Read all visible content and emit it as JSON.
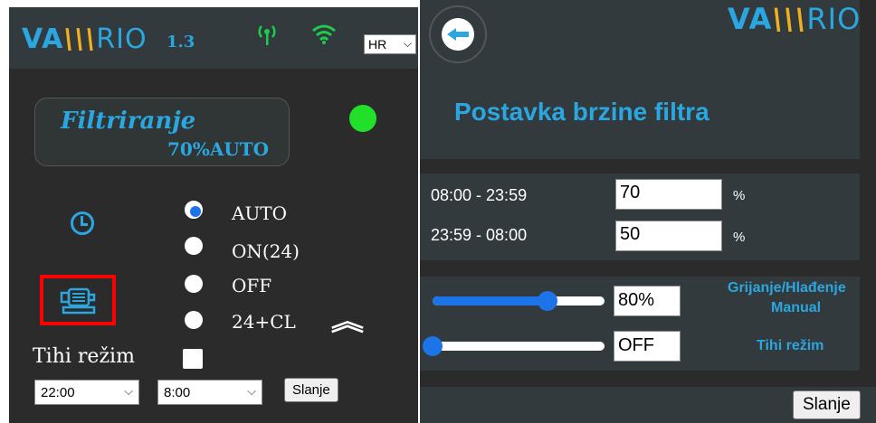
{
  "left_panel": {
    "logo": {
      "va": "VA",
      "bars": "\\\\\\",
      "rio": "RIO"
    },
    "version": "1.3",
    "language": "HR",
    "filter_title": "Filtriranje",
    "filter_value": "70%AUTO",
    "status_led_color": "#22e02a",
    "modes": [
      {
        "label": "AUTO",
        "selected": true
      },
      {
        "label": "ON(24)",
        "selected": false
      },
      {
        "label": "OFF",
        "selected": false
      },
      {
        "label": "24+CL",
        "selected": false
      }
    ],
    "quiet_mode_label": "Tihi režim",
    "quiet_mode_checked": false,
    "time_start": "22:00",
    "time_end": "8:00",
    "send_label": "Slanje"
  },
  "right_panel": {
    "logo": {
      "va": "VA",
      "bars": "\\\\\\",
      "rio": "RIO"
    },
    "title": "Postavka brzine filtra",
    "schedule": [
      {
        "time": "08:00 - 23:59",
        "value": "70",
        "unit": "%"
      },
      {
        "time": "23:59 - 08:00",
        "value": "50",
        "unit": "%"
      }
    ],
    "sliders": [
      {
        "value_text": "80%",
        "level": 0.67,
        "label_line1": "Grijanje/Hlađenje",
        "label_line2": "Manual"
      },
      {
        "value_text": "OFF",
        "level": 0.0,
        "label_line1": "Tihi režim"
      }
    ],
    "send_label": "Slanje"
  },
  "colors": {
    "accent": "#2aa7e0",
    "brand_yellow": "#f0b020",
    "panel_bg": "#2b2b2b",
    "header_bg": "#333a3d",
    "control_blue": "#1d73e8",
    "highlight_red": "#ff0000"
  },
  "icons": [
    "signal-tower-icon",
    "wifi-icon",
    "chevron-down-icon",
    "clock-icon",
    "pump-motor-icon",
    "double-chevron-up-icon",
    "back-arrow-icon"
  ]
}
